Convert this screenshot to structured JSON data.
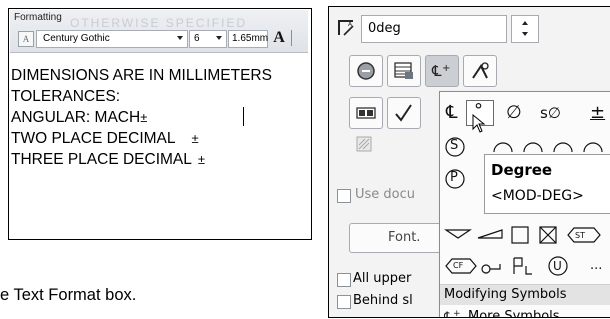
{
  "formatting_box": {
    "title": "Formatting",
    "background_text": "OTHERWISE SPECIFIED",
    "font_name": "Century Gothic",
    "font_size": "6",
    "text_height": "1.65mm",
    "bold_label": "A"
  },
  "notes": {
    "lines": [
      {
        "text": "DIMENSIONS ARE IN MILLIMETERS",
        "suffix": ""
      },
      {
        "text": "TOLERANCES:",
        "suffix": ""
      },
      {
        "text": "ANGULAR: MACH",
        "suffix": "±"
      },
      {
        "text": "TWO PLACE DECIMAL",
        "suffix": "±"
      },
      {
        "text": "THREE PLACE DECIMAL",
        "suffix": "±"
      }
    ]
  },
  "caption": "e Text Format box.",
  "property_panel": {
    "angle_value": "0deg",
    "use_doc_label": "Use docu",
    "font_button_label": "Font.",
    "all_upper_label": "All upper",
    "behind_label": "Behind sl"
  },
  "symbol_menu": {
    "row1": [
      "℄",
      "°",
      "∅",
      "s∅",
      "±"
    ],
    "tooltip_title": "Degree",
    "tooltip_code": "<MOD-DEG>",
    "st_label": "ST",
    "cf_label": "CF",
    "u_label": "U",
    "ellipsis": "...",
    "s_label": "S",
    "p_label": "P",
    "modifying_label": "Modifying Symbols",
    "more_label": "More Symbols..."
  },
  "colors": {
    "panel_bg": "#f3f3f3",
    "popup_bg": "#fbfbfb",
    "tooltip_border": "#9a9a9a"
  }
}
